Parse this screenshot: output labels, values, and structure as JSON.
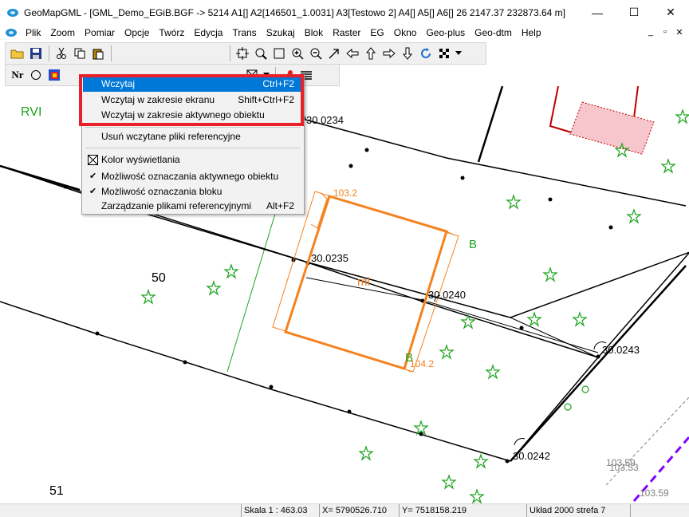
{
  "window": {
    "title": "GeoMapGML - [GML_Demo_EGiB.BGF -> 5214 A1[]  A2[146501_1.0031]  A3[Testowo 2]  A4[]  A5[]  A6[]  26     2147.37    232873.64 m]",
    "min_glyph": "—",
    "max_glyph": "☐",
    "close_glyph": "✕"
  },
  "menubar": {
    "items": [
      "Plik",
      "Zoom",
      "Pomiar",
      "Opcje",
      "Twórz",
      "Edycja",
      "Trans",
      "Szukaj",
      "Blok",
      "Raster",
      "EG",
      "Okno",
      "Geo-plus",
      "Geo-dtm",
      "Help"
    ],
    "mdi_min": "_",
    "mdi_restore": "▫",
    "mdi_close": "✕"
  },
  "toolbar2": {
    "nr_label": "Nr"
  },
  "dropdown": {
    "items": [
      {
        "label": "Wczytaj",
        "shortcut": "Ctrl+F2"
      },
      {
        "label": "Wczytaj w zakresie ekranu",
        "shortcut": "Shift+Ctrl+F2"
      },
      {
        "label": "Wczytaj w zakresie aktywnego obiektu",
        "shortcut": ""
      },
      {
        "label": "Usuń wczytane pliki referencyjne",
        "shortcut": ""
      },
      {
        "label": "Kolor wyświetlania",
        "shortcut": ""
      },
      {
        "label": "Możliwość oznaczania aktywnego obiektu",
        "shortcut": ""
      },
      {
        "label": "Możliwość oznaczania bloku",
        "shortcut": ""
      },
      {
        "label": "Zarządzanie plikami referencyjnymi",
        "shortcut": "Alt+F2"
      }
    ],
    "check_mark": "✔"
  },
  "map": {
    "labels": {
      "rvi": "RVI",
      "p50": "50",
      "p51": "51",
      "b1": "B",
      "b2": "B",
      "ml": "ml",
      "p0234": "30.0234",
      "p0235": "30.0235",
      "p0240": "30.0240",
      "p0243": "30.0243",
      "p0242": "30.0242",
      "h1032": "103.2",
      "h1042": "104.2",
      "h10359a": "103.59",
      "h10359b": "103.59",
      "h10353": "103.53"
    }
  },
  "statusbar": {
    "scale": "Skala 1 : 463.03",
    "x": "X= 5790526.710",
    "y": "Y= 7518158.219",
    "system": "Układ 2000 strefa 7"
  },
  "colors": {
    "accent": "#0078d7",
    "highlight_border": "#e8202a",
    "building": "#f5821f",
    "green": "#1fa31f",
    "red": "#c00000",
    "purple": "#8000ff"
  }
}
